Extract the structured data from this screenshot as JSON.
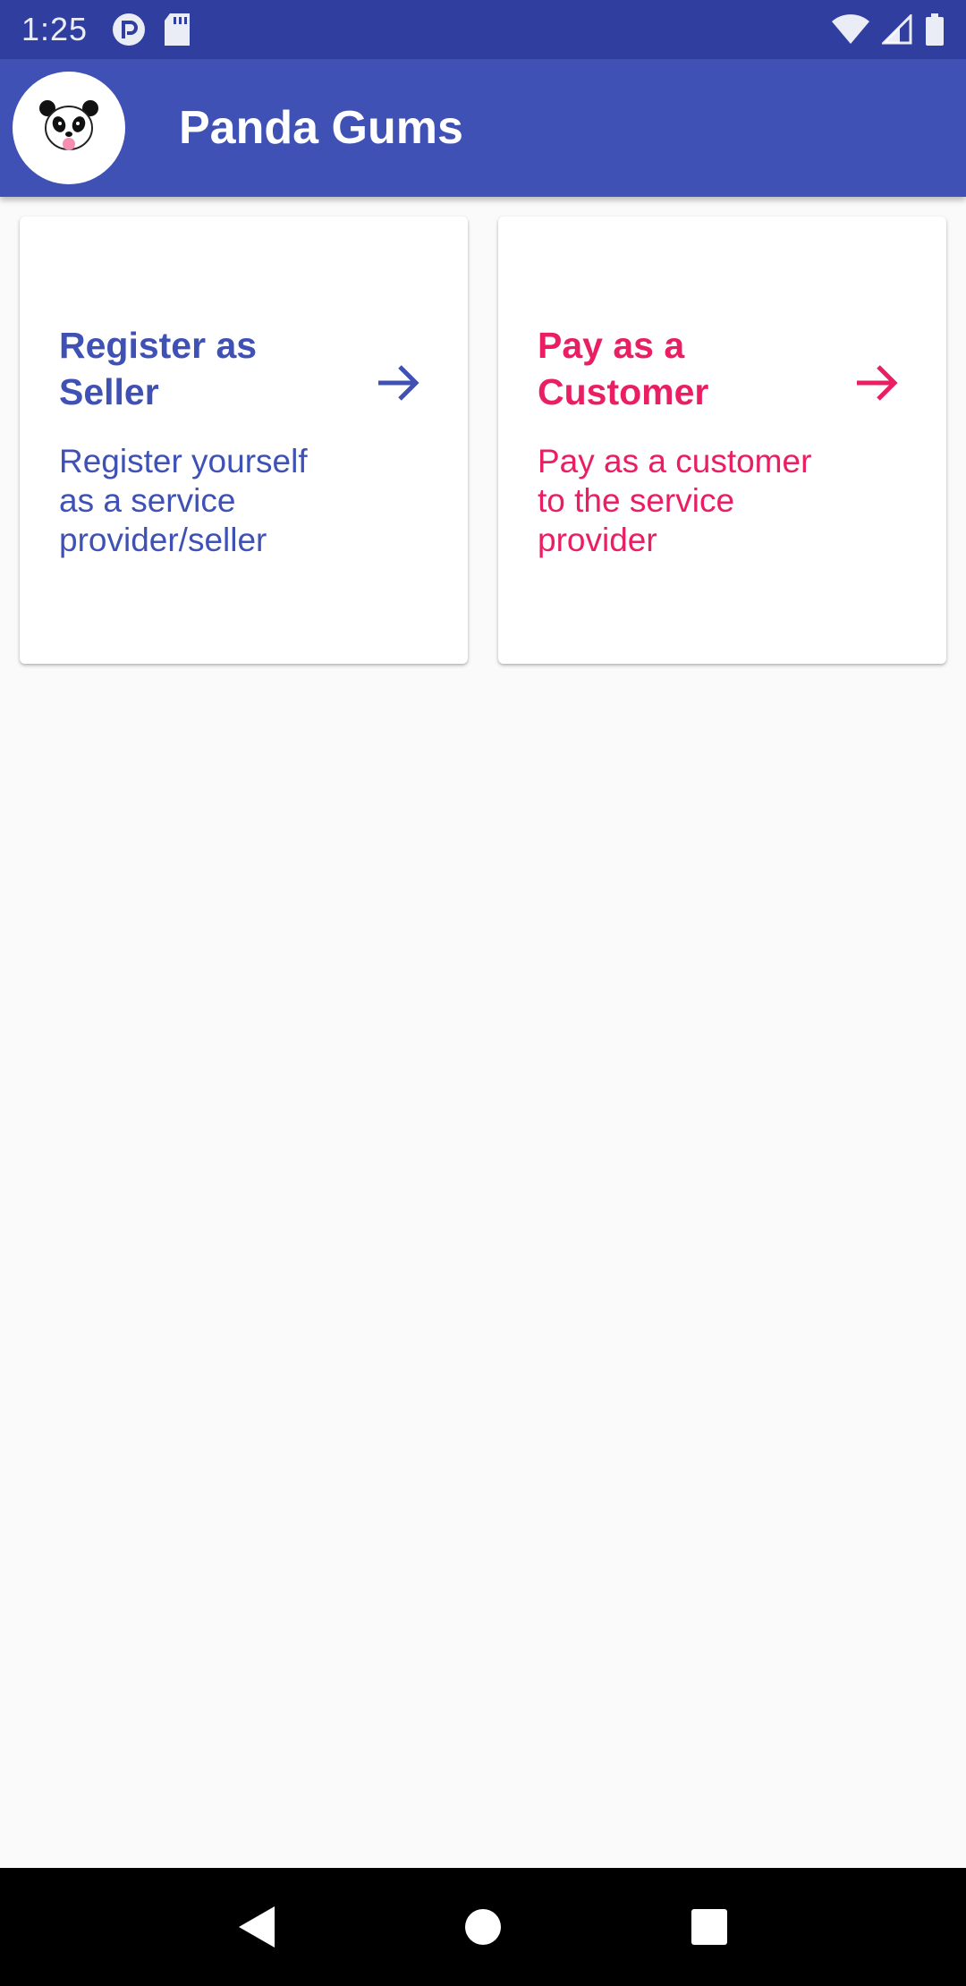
{
  "status_bar": {
    "time": "1:25",
    "icons": [
      "pocket-icon",
      "sd-card-icon",
      "wifi-icon",
      "signal-icon",
      "battery-icon"
    ]
  },
  "app_bar": {
    "title": "Panda Gums",
    "logo_icon": "panda-logo-icon",
    "color": "#3f51b5"
  },
  "cards": [
    {
      "title": "Register as Seller",
      "description": "Register yourself as a service provider/seller",
      "icon": "arrow-right-icon",
      "color": "#3f51b5"
    },
    {
      "title": "Pay as a Customer",
      "description": "Pay as a customer to the service provider",
      "icon": "arrow-right-icon",
      "color": "#e91e63"
    }
  ],
  "nav_bar": {
    "icons": [
      "back-icon",
      "home-icon",
      "recents-icon"
    ]
  }
}
